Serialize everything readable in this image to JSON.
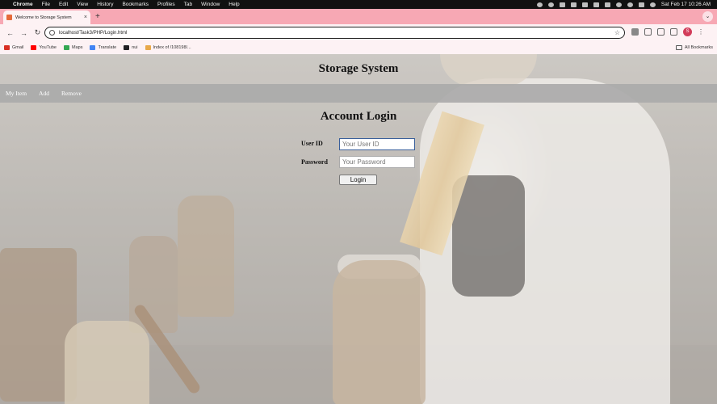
{
  "menubar": {
    "app": "Chrome",
    "items": [
      "File",
      "Edit",
      "View",
      "History",
      "Bookmarks",
      "Profiles",
      "Tab",
      "Window",
      "Help"
    ],
    "datetime": "Sat Feb 17  10:26 AM"
  },
  "browser": {
    "tab_title": "Welcome to Storage System",
    "new_tab": "+",
    "url": "localhost/Task3/PHP/Login.html",
    "avatar_letter": "S",
    "bookmarks": [
      {
        "label": "Gmail",
        "color": "#d93025"
      },
      {
        "label": "YouTube",
        "color": "#ff0000"
      },
      {
        "label": "Maps",
        "color": "#34a853"
      },
      {
        "label": "Translate",
        "color": "#4285f4"
      },
      {
        "label": "nui",
        "color": "#202124"
      },
      {
        "label": "Index of /108198/...",
        "color": "#e8a94a"
      }
    ],
    "all_bookmarks": "All Bookmarks"
  },
  "site": {
    "title": "Storage System",
    "nav": [
      "My Item",
      "Add",
      "Remove"
    ],
    "login": {
      "heading": "Account Login",
      "user_label": "User ID",
      "user_placeholder": "Your User ID",
      "password_label": "Password",
      "password_placeholder": "Your Password",
      "button": "Login"
    }
  }
}
